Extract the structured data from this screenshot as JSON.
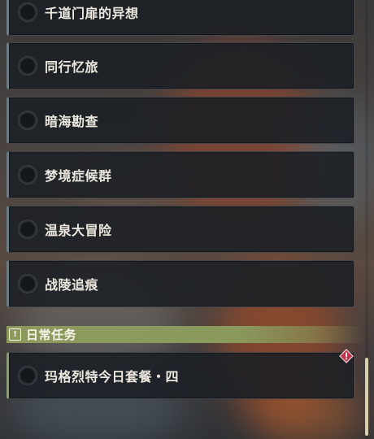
{
  "quests": [
    {
      "label": "千道门扉的异想"
    },
    {
      "label": "同行忆旅"
    },
    {
      "label": "暗海勘查"
    },
    {
      "label": "梦境症候群"
    },
    {
      "label": "温泉大冒险"
    },
    {
      "label": "战陵追痕"
    }
  ],
  "daily_section": {
    "title": "日常任务",
    "icon": "exclamation-box-icon",
    "quests": [
      {
        "label": "玛格烈特今日套餐・四",
        "badge": "alert-diamond-icon"
      }
    ]
  },
  "colors": {
    "section_bar": "#8c9a5e",
    "alert": "#c0324a",
    "scroll_thumb": "#d8cfae"
  }
}
